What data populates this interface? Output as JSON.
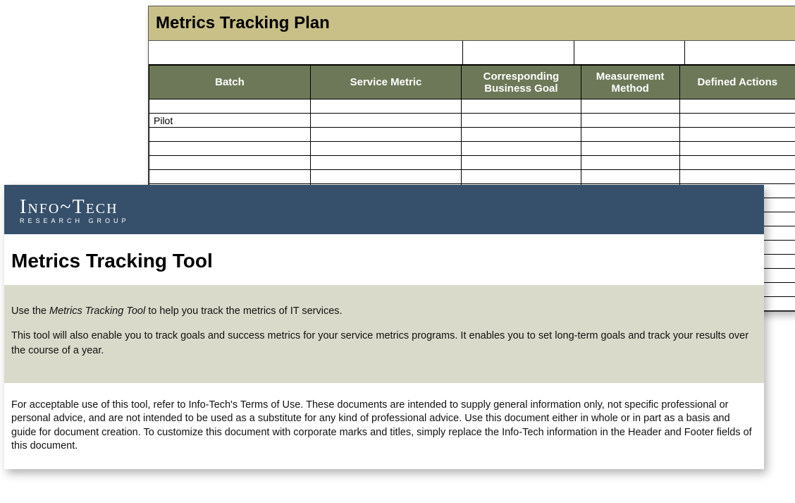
{
  "plan": {
    "title": "Metrics Tracking Plan",
    "columns": [
      "Batch",
      "Service Metric",
      "Corresponding Business Goal",
      "Measurement Method",
      "Defined Actions"
    ],
    "rows": [
      [
        "",
        "",
        "",
        "",
        ""
      ],
      [
        "Pilot",
        "",
        "",
        "",
        ""
      ],
      [
        "",
        "",
        "",
        "",
        ""
      ],
      [
        "",
        "",
        "",
        "",
        ""
      ],
      [
        "",
        "",
        "",
        "",
        ""
      ],
      [
        "",
        "",
        "",
        "",
        ""
      ],
      [
        "",
        "",
        "",
        "",
        ""
      ],
      [
        "",
        "",
        "",
        "",
        ""
      ],
      [
        "",
        "",
        "",
        "",
        ""
      ],
      [
        "",
        "",
        "",
        "",
        ""
      ],
      [
        "",
        "",
        "",
        "",
        ""
      ],
      [
        "",
        "",
        "",
        "",
        ""
      ],
      [
        "",
        "",
        "",
        "",
        ""
      ],
      [
        "",
        "",
        "",
        "",
        ""
      ],
      [
        "",
        "",
        "",
        "",
        ""
      ]
    ]
  },
  "brand": {
    "name": "Info~Tech",
    "sub": "RESEARCH GROUP"
  },
  "tool": {
    "title": "Metrics Tracking Tool",
    "intro_pre": "Use the ",
    "intro_tool_name": "Metrics Tracking Tool",
    "intro_post": " to help you track the metrics of IT services.",
    "intro_p2": "This tool will also enable you to track goals and success metrics for your service metrics programs. It enables you to set long-term goals and track your results over the course of a year.",
    "footer": "For acceptable use of this tool, refer to Info-Tech's Terms of Use. These documents are intended to supply general information only, not specific professional or personal advice, and are not intended to be used as a substitute for any kind of professional advice. Use this document either in whole or in part as a basis and guide for document creation. To customize this document with corporate marks and titles, simply replace the Info-Tech information in the Header and Footer fields of this document."
  }
}
